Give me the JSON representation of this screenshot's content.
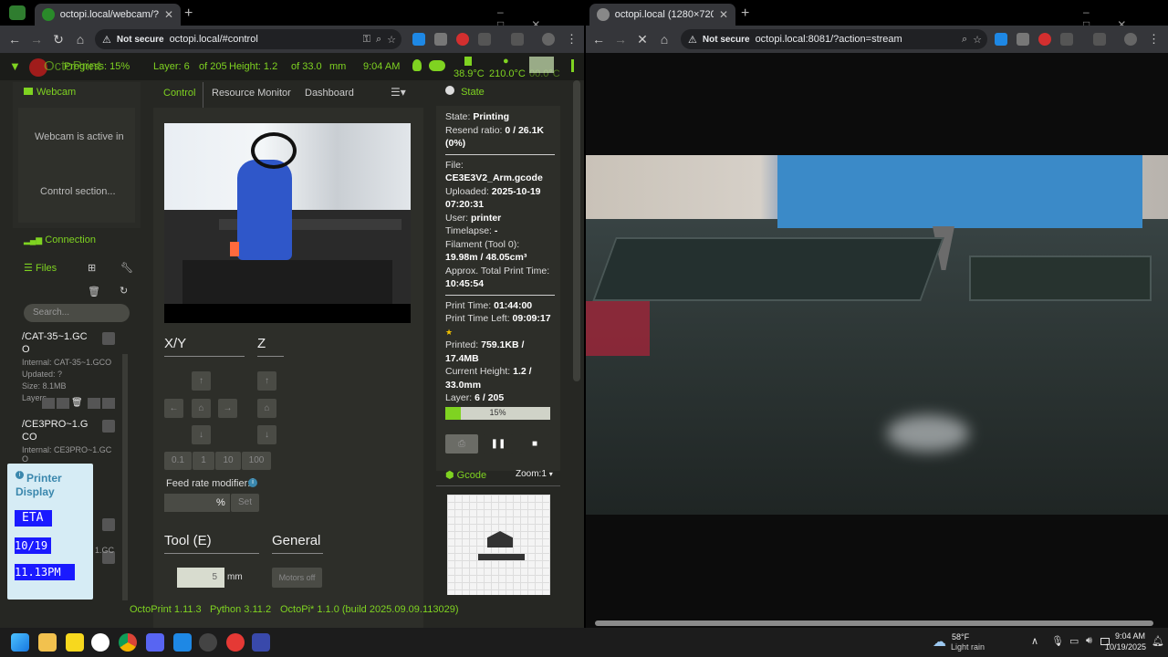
{
  "left_window": {
    "tab_title": "octopi.local/webcam/?action=s",
    "security": "Not secure",
    "url": "octopi.local/#control"
  },
  "right_window": {
    "tab_title": "octopi.local (1280×720)",
    "security": "Not secure",
    "url": "octopi.local:8081/?action=stream"
  },
  "navbar": {
    "brand": "OctoPrint",
    "progress": "Progress: 15%",
    "layer": "Layer: 6",
    "of_layers": "of 205",
    "height": "Height: 1.2",
    "of_height": "of 33.0",
    "unit": "mm",
    "time": "9:04 AM",
    "temp_bed": "38.9°C",
    "temp_tool": "210.0°C",
    "temp_other": "00.0°C"
  },
  "sidebar": {
    "webcam_title": "Webcam",
    "webcam_msg1": "Webcam is active in",
    "webcam_msg2": "Control section...",
    "connection_title": "Connection",
    "files_title": "Files",
    "search_placeholder": "Search...",
    "files": [
      {
        "name": "/CAT-35~1.GC O",
        "internal": "Internal: CAT-35~1.GCO",
        "updated": "Updated: ?",
        "size": "Size: 8.1MB",
        "layers": "Layers"
      },
      {
        "name": "/CE3PRO~1.G CO",
        "internal": "Internal: CE3PRO~1.GC O",
        "extra": "1.GC"
      }
    ]
  },
  "printer_display": {
    "title": "Printer Display",
    "lines": [
      "ETA",
      "10/19",
      "11.13PM"
    ]
  },
  "control": {
    "tabs": [
      "Control",
      "Resource Monitor",
      "Dashboard"
    ],
    "xy_label": "X/Y",
    "z_label": "Z",
    "steps": [
      "0.1",
      "1",
      "10",
      "100"
    ],
    "feed_label": "Feed rate modifier:",
    "feed_unit": "%",
    "set_label": "Set",
    "tool_label": "Tool (E)",
    "general_label": "General",
    "extrude_value": "5",
    "extrude_unit": "mm",
    "motors_off": "Motors off"
  },
  "state": {
    "title": "State",
    "state_label": "State:",
    "state_value": "Printing",
    "resend_label": "Resend ratio:",
    "resend_value": "0 / 26.1K",
    "resend_pct": "(0%)",
    "file_label": "File:",
    "file_value": "CE3E3V2_Arm.gcode",
    "uploaded_label": "Uploaded:",
    "uploaded_value": "2025-10-19",
    "uploaded_time": "07:20:31",
    "user_label": "User:",
    "user_value": "printer",
    "timelapse_label": "Timelapse:",
    "timelapse_value": "-",
    "filament_label": "Filament (Tool 0):",
    "filament_value": "19.98m / 48.05cm³",
    "approx_label": "Approx. Total Print Time:",
    "approx_value": "10:45:54",
    "print_time_label": "Print Time:",
    "print_time_value": "01:44:00",
    "left_label": "Print Time Left:",
    "left_value": "09:09:17",
    "star": "★",
    "printed_label": "Printed:",
    "printed_value": "759.1KB /",
    "printed_total": "17.4MB",
    "cur_height_label": "Current Height:",
    "cur_height_value": "1.2 /",
    "cur_height_total": "33.0mm",
    "layer_label": "Layer:",
    "layer_value": "6 / 205",
    "progress_text": "15%",
    "progress_fraction": 0.15
  },
  "gcode": {
    "title": "Gcode",
    "zoom": "Zoom:1"
  },
  "footer": {
    "octoprint": "OctoPrint 1.11.3",
    "python": "Python 3.11.2",
    "octopi": "OctoPi* 1.1.0 (build 2025.09.09.113029)"
  },
  "taskbar": {
    "weather_temp": "58°F",
    "weather_desc": "Light rain",
    "clock_time": "9:04 AM",
    "clock_date": "10/19/2025"
  },
  "colors": {
    "accent": "#7fd321",
    "navbar_bg": "#1b1c19",
    "panel_bg": "#2d2e29"
  }
}
